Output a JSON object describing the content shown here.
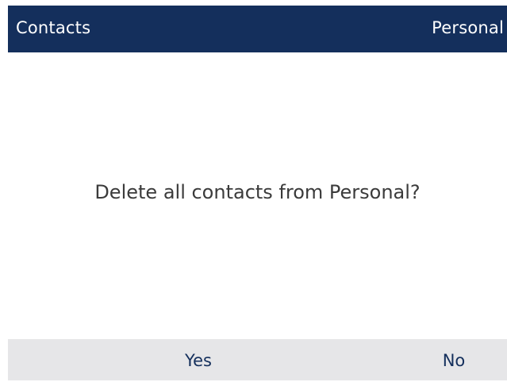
{
  "header": {
    "title": "Contacts",
    "context": "Personal"
  },
  "dialog": {
    "message": "Delete all contacts from Personal?"
  },
  "softkeys": {
    "yes_label": "Yes",
    "no_label": "No"
  },
  "colors": {
    "header_bg": "#142f5c",
    "softkey_bg": "#e6e6e8",
    "softkey_text": "#142f5c",
    "message_text": "#3b3b3b"
  }
}
